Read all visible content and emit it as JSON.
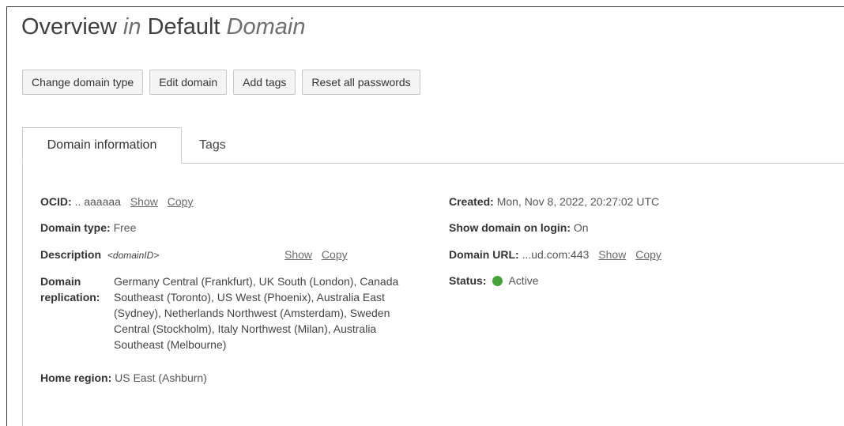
{
  "header": {
    "title_part1": "Overview",
    "title_in": "in",
    "title_part2": "Default",
    "title_domain": "Domain"
  },
  "toolbar": {
    "change_type": "Change domain type",
    "edit": "Edit domain",
    "add_tags": "Add tags",
    "reset": "Reset all passwords"
  },
  "tabs": {
    "domain_info": "Domain information",
    "tags": "Tags"
  },
  "info": {
    "ocid_label": "OCID:",
    "ocid_value": ".. aaaaaa",
    "show": "Show",
    "copy": "Copy",
    "domain_type_label": "Domain type:",
    "domain_type_value": "Free",
    "description_label": "Description",
    "description_value": "<domainID>",
    "replication_label_1": "Domain",
    "replication_label_2": "replication:",
    "replication_value": "Germany Central (Frankfurt), UK South (London), Canada Southeast (Toronto), US West (Phoenix), Australia East (Sydney), Netherlands Northwest (Amsterdam), Sweden Central (Stockholm), Italy Northwest (Milan), Australia Southeast (Melbourne)",
    "home_region_label": "Home region:",
    "home_region_value": "US East (Ashburn)",
    "created_label": "Created:",
    "created_value": "Mon, Nov 8, 2022, 20:27:02 UTC",
    "show_on_login_label": "Show domain on login:",
    "show_on_login_value": "On",
    "url_label": "Domain URL:",
    "url_value": "...ud.com:443",
    "status_label": "Status:",
    "status_value": "Active",
    "status_color": "#46a23a"
  }
}
